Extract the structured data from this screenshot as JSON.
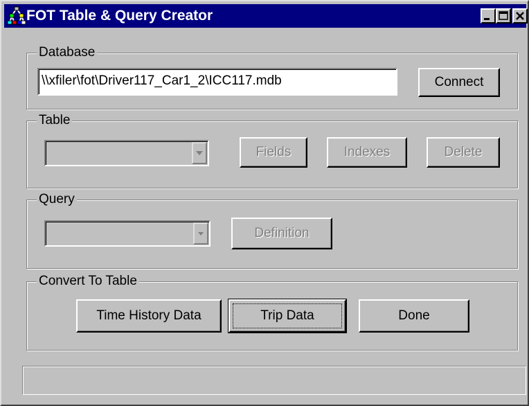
{
  "window": {
    "title": "FOT Table & Query Creator",
    "icon": "app-tree-icon",
    "controls": [
      "minimize-icon",
      "maximize-icon",
      "close-icon"
    ]
  },
  "database": {
    "legend": "Database",
    "path": "\\\\xfiler\\fot\\Driver117_Car1_2\\ICC117.mdb",
    "connect_label": "Connect"
  },
  "table": {
    "legend": "Table",
    "selected": "",
    "fields_label": "Fields",
    "indexes_label": "Indexes",
    "delete_label": "Delete"
  },
  "query": {
    "legend": "Query",
    "selected": "",
    "definition_label": "Definition"
  },
  "convert": {
    "legend": "Convert To Table",
    "time_history_label": "Time History Data",
    "trip_data_label": "Trip Data",
    "done_label": "Done"
  },
  "status": {
    "text": ""
  }
}
